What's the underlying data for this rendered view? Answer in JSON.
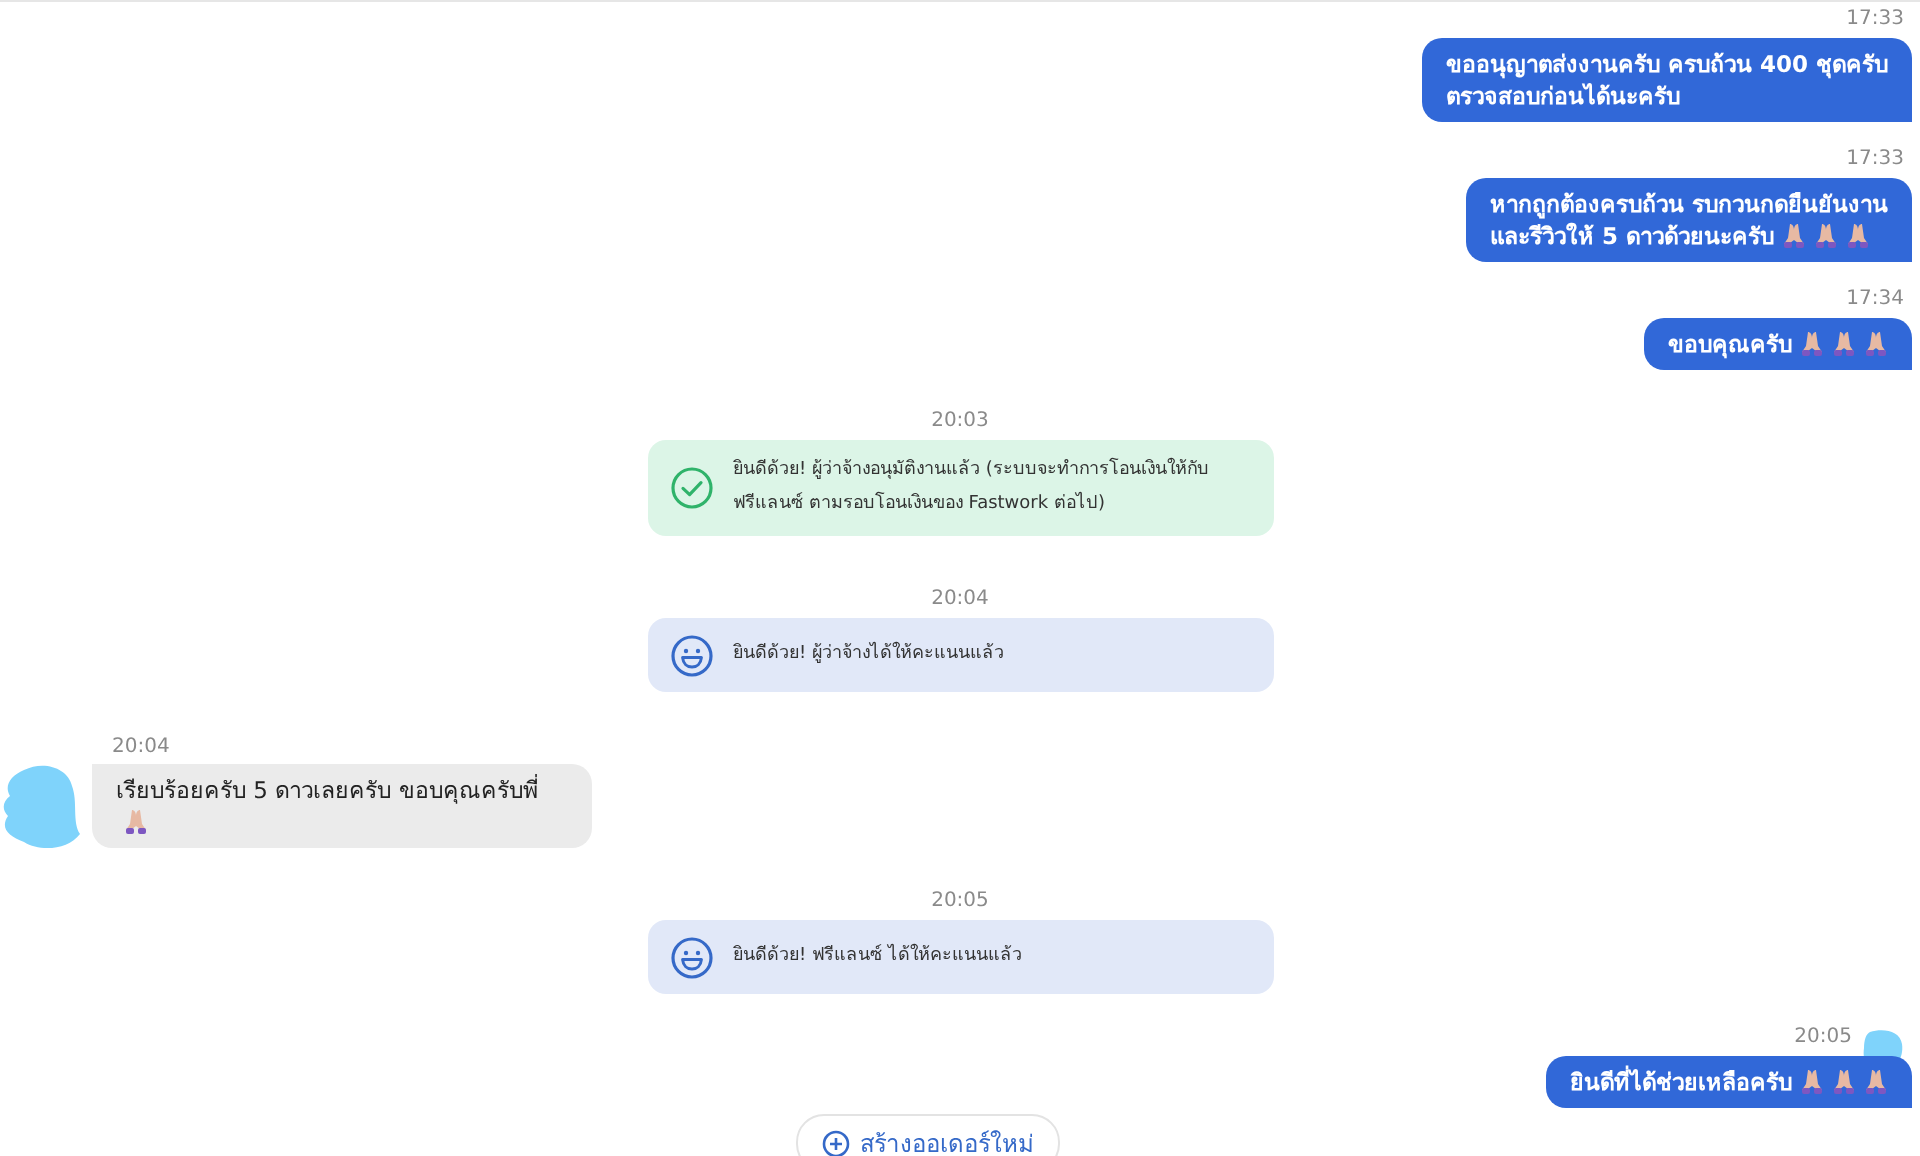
{
  "messages": [
    {
      "kind": "outgoing",
      "time": "17:33",
      "text": "ขออนุญาตส่งงานครับ ครบถ้วน 400 ชุดครับ\nตรวจสอบก่อนได้นะครับ"
    },
    {
      "kind": "outgoing",
      "time": "17:33",
      "text": "หากถูกต้องครบถ้วน รบกวนกดยืนยันงาน\nและรีวิวให้ 5 ดาวด้วยนะครับ",
      "reactions": [
        {
          "kind": "hands"
        },
        {
          "kind": "hands"
        },
        {
          "kind": "hands"
        }
      ]
    },
    {
      "kind": "outgoing",
      "time": "17:34",
      "text": "ขอบคุณครับ",
      "reactions": [
        {
          "kind": "hands"
        },
        {
          "kind": "hands"
        },
        {
          "kind": "hands"
        }
      ]
    },
    {
      "kind": "approval_notice",
      "time": "20:03",
      "text": "ยินดีด้วย! ผู้ว่าจ้างอนุมัติงานแล้ว (ระบบจะทำการโอนเงินให้กับ\nฟรีแลนซ์ ตามรอบโอนเงินของ Fastwork ต่อไป)"
    },
    {
      "kind": "rating_notice",
      "time": "20:04",
      "text": "ยินดีด้วย! ผู้ว่าจ้างได้ให้คะแนนแล้ว"
    },
    {
      "kind": "incoming",
      "time": "20:04",
      "text": "เรียบร้อยครับ 5 ดาวเลยครับ ขอบคุณครับพี่",
      "reactions": [
        {
          "kind": "hands"
        }
      ]
    },
    {
      "kind": "rating_notice",
      "time": "20:05",
      "text": "ยินดีด้วย! ฟรีแลนซ์ ได้ให้คะแนนแล้ว"
    },
    {
      "kind": "outgoing",
      "time": "20:05",
      "text": "ยินดีที่ได้ช่วยเหลือครับ",
      "reactions": [
        {
          "kind": "hands"
        },
        {
          "kind": "hands"
        },
        {
          "kind": "hands"
        }
      ],
      "blurred_avatar": true
    }
  ],
  "new_order_button": {
    "label": "สร้างออเดอร์ใหม่"
  }
}
